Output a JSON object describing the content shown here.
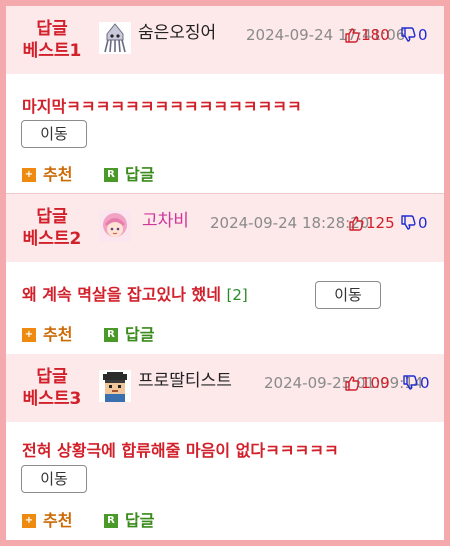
{
  "posts": [
    {
      "badge_line1": "답글",
      "badge_line2": "베스트1",
      "nickname": "숨은오징어",
      "nick_color": "#222222",
      "date": "2024-09-24 17:41:06",
      "up": "180",
      "down": "0",
      "title": "마지막ㅋㅋㅋㅋㅋㅋㅋㅋㅋㅋㅋㅋㅋㅋㅋㅋ",
      "reply_count": "",
      "move_label": "이동",
      "recommend_label": "추천",
      "reply_label": "답글"
    },
    {
      "badge_line1": "답글",
      "badge_line2": "베스트2",
      "nickname": "고차비",
      "nick_color": "#d0369a",
      "date": "2024-09-24 18:28:20",
      "up": "125",
      "down": "0",
      "title": "왜 계속 멱살을 잡고있나 했네",
      "reply_count": "[2]",
      "move_label": "이동",
      "recommend_label": "추천",
      "reply_label": "답글"
    },
    {
      "badge_line1": "답글",
      "badge_line2": "베스트3",
      "nickname": "프로딸티스트",
      "nick_color": "#222222",
      "date": "2024-09-25 01:09:14",
      "up": "109",
      "down": "0",
      "title": "전혀 상황극에 합류해줄 마음이 없다ㅋㅋㅋㅋㅋ",
      "reply_count": "",
      "move_label": "이동",
      "recommend_label": "추천",
      "reply_label": "답글"
    }
  ],
  "icons": {
    "avatar1": "squid-avatar-icon",
    "avatar2": "anime-girl-avatar-icon",
    "avatar3": "pixel-man-avatar-icon",
    "up": "thumbs-up-icon",
    "down": "thumbs-down-icon",
    "recommend": "plus-badge-icon",
    "reply": "r-badge-icon"
  },
  "colors": {
    "frame_border": "#f4a9ad",
    "header_bg": "#fde8ea",
    "best_label": "#d2202b",
    "title": "#d2202b",
    "up_count": "#d2202b",
    "down_count": "#1f2bd0",
    "recommend": "#cc6a06",
    "reply": "#3a8a1c"
  }
}
